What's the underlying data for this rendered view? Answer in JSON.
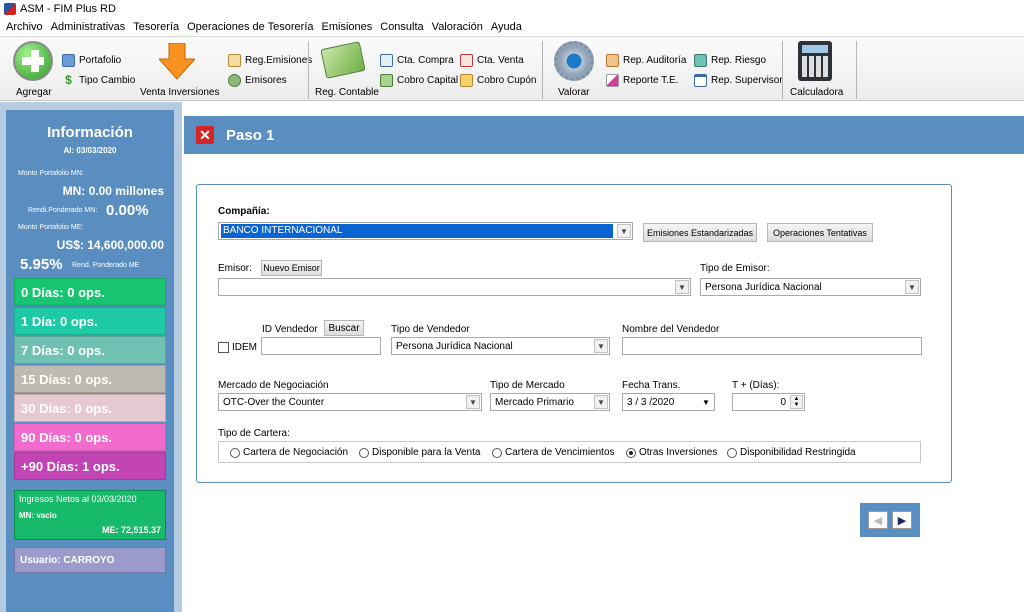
{
  "window": {
    "title": "ASM - FIM Plus RD"
  },
  "menu": [
    "Archivo",
    "Administrativas",
    "Tesorería",
    "Operaciones de Tesorería",
    "Emisiones",
    "Consulta",
    "Valoración",
    "Ayuda"
  ],
  "toolbar": {
    "agregar": "Agregar",
    "portafolio": "Portafolio",
    "tipo_cambio": "Tipo Cambio",
    "venta_inversiones": "Venta Inversiones",
    "reg_emisiones": "Reg.Emisiones",
    "emisores": "Emisores",
    "reg_contable": "Reg. Contable",
    "cta_compra": "Cta. Compra",
    "cobro_capital": "Cobro Capital",
    "cta_venta": "Cta. Venta",
    "cobro_cupon": "Cobro Cupón",
    "valorar": "Valorar",
    "rep_auditoria": "Rep. Auditoría",
    "reporte_te": "Reporte T.E.",
    "rep_riesgo": "Rep. Riesgo",
    "rep_supervisor": "Rep. Supervisor",
    "calculadora": "Calculadora"
  },
  "info": {
    "title": "Información",
    "date": "Al: 03/03/2020",
    "monto_mn_label": "Monto Portafolio MN:",
    "monto_mn": "MN: 0.00 millones",
    "rendi_mn_label": "Rendi.Ponderado MN:",
    "rendi_mn": "0.00%",
    "monto_me_label": "Monto Portafolio ME:",
    "monto_me": "US$: 14,600,000.00",
    "rendi_me": "5.95%",
    "rendi_me_label": "Rend. Ponderado ME",
    "days": [
      {
        "label": "0 Días: 0 ops.",
        "color": "#17c46f"
      },
      {
        "label": "1 Día: 0 ops.",
        "color": "#1ec9a6"
      },
      {
        "label": "7 Días: 0 ops.",
        "color": "#6fc2b3"
      },
      {
        "label": "15 Días: 0 ops.",
        "color": "#bdbab0"
      },
      {
        "label": "30 Días: 0 ops.",
        "color": "#e7c9d1"
      },
      {
        "label": "90 Días: 0 ops.",
        "color": "#f46bd0"
      },
      {
        "label": "+90 Días: 1 ops.",
        "color": "#c243b4"
      }
    ],
    "ingresos_title": "Ingresos Netos al 03/03/2020",
    "ingresos_mn": "MN: vacio",
    "ingresos_me": "ME: 72,515.37",
    "usuario": "Usuario: CARROYO"
  },
  "step": {
    "title": "Paso 1"
  },
  "form": {
    "compania_label": "Compañía:",
    "compania_value": "BANCO INTERNACIONAL",
    "btn_emisiones": "Emisiones Estandarizadas",
    "btn_operaciones": "Operaciones Tentativas",
    "emisor_label": "Emisor:",
    "btn_nuevo_emisor": "Nuevo Emisor",
    "emisor_value": "",
    "tipo_emisor_label": "Tipo de Emisor:",
    "tipo_emisor_value": "Persona Jurídica Nacional",
    "id_vendedor_label": "ID Vendedor",
    "btn_buscar": "Buscar",
    "idem_label": "IDEM",
    "id_vendedor_value": "",
    "tipo_vendedor_label": "Tipo de Vendedor",
    "tipo_vendedor_value": "Persona Jurídica Nacional",
    "nombre_vendedor_label": "Nombre del Vendedor",
    "nombre_vendedor_value": "",
    "mercado_neg_label": "Mercado de Negociación",
    "mercado_neg_value": "OTC-Over the Counter",
    "tipo_mercado_label": "Tipo de Mercado",
    "tipo_mercado_value": "Mercado Primario",
    "fecha_label": "Fecha Trans.",
    "fecha_value": "3 / 3 /2020",
    "t_dias_label": "T + (Días):",
    "t_dias_value": "0",
    "tipo_cartera_label": "Tipo de Cartera:",
    "carteras": [
      "Cartera de Negociación",
      "Disponible para la Venta",
      "Cartera de Vencimientos",
      "Otras Inversiones",
      "Disponibilidad Restringida"
    ],
    "cartera_selected": "Otras Inversiones"
  }
}
